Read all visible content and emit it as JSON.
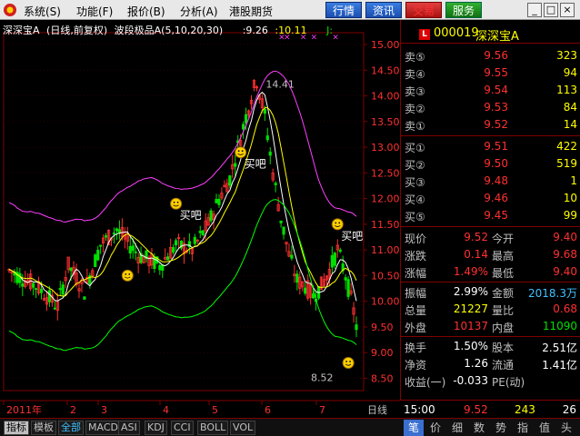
{
  "menu": {
    "items": [
      "系统(S)",
      "功能(F)",
      "报价(B)",
      "分析(A)",
      "港股期货"
    ],
    "buttons": [
      "行情",
      "资讯",
      "交易",
      "服务"
    ],
    "window": [
      "_",
      "□",
      "×"
    ]
  },
  "chart_header": {
    "title": "深深宝A",
    "mode": "(日线,前复权)",
    "indicator": "波段极品A(5,10,20,30)",
    "val1": ":9.26",
    "val2": ":10.11",
    "val3": "J:"
  },
  "annotations": {
    "high": "14.41",
    "low": "8.52",
    "buy": "买吧"
  },
  "xaxis": {
    "labels": [
      "2011年",
      "2",
      "3",
      "4",
      "5",
      "6",
      "7"
    ],
    "period": "日线"
  },
  "chart_data": {
    "type": "candlestick",
    "yaxis_ticks": [
      15.0,
      14.5,
      14.0,
      13.5,
      13.0,
      12.5,
      12.0,
      11.5,
      11.0,
      10.5,
      10.0,
      9.5,
      9.0,
      8.5
    ],
    "ylim": [
      8.26,
      15.23
    ],
    "x_labels": [
      "2011年",
      "2",
      "3",
      "4",
      "5",
      "6",
      "7"
    ],
    "high_label": 14.41,
    "low_label": 8.52
  },
  "quote": {
    "badge": "L",
    "code": "000019",
    "name": "深深宝A",
    "asks": [
      {
        "label": "卖⑤",
        "price": "9.56",
        "vol": "323"
      },
      {
        "label": "卖④",
        "price": "9.55",
        "vol": "94"
      },
      {
        "label": "卖③",
        "price": "9.54",
        "vol": "113"
      },
      {
        "label": "卖②",
        "price": "9.53",
        "vol": "84"
      },
      {
        "label": "卖①",
        "price": "9.52",
        "vol": "14"
      }
    ],
    "bids": [
      {
        "label": "买①",
        "price": "9.51",
        "vol": "422"
      },
      {
        "label": "买②",
        "price": "9.50",
        "vol": "519"
      },
      {
        "label": "买③",
        "price": "9.48",
        "vol": "1"
      },
      {
        "label": "买④",
        "price": "9.46",
        "vol": "10"
      },
      {
        "label": "买⑤",
        "price": "9.45",
        "vol": "99"
      }
    ],
    "stats": [
      {
        "l1": "现价",
        "v1": "9.52",
        "l2": "今开",
        "v2": "9.40"
      },
      {
        "l1": "涨跌",
        "v1": "0.14",
        "l2": "最高",
        "v2": "9.68"
      },
      {
        "l1": "涨幅",
        "v1": "1.49%",
        "l2": "最低",
        "v2": "9.40"
      }
    ],
    "stats2": [
      {
        "l1": "振幅",
        "v1": "2.99%",
        "l2": "金额",
        "v2": "2018.3万"
      },
      {
        "l1": "总量",
        "v1": "21227",
        "l2": "量比",
        "v2": "0.68"
      },
      {
        "l1": "外盘",
        "v1": "10137",
        "l2": "内盘",
        "v2": "11090"
      }
    ],
    "stats3": [
      {
        "l1": "换手",
        "v1": "1.50%",
        "l2": "股本",
        "v2": "2.51亿"
      },
      {
        "l1": "净资",
        "v1": "1.26",
        "l2": "流通",
        "v2": "1.41亿"
      },
      {
        "l1": "收益(一)",
        "v1": "-0.033",
        "l2": "PE(动)",
        "v2": ""
      }
    ],
    "tick": {
      "time": "15:00",
      "price": "9.52",
      "vol": "243",
      "count": "26"
    }
  },
  "bottom_tabs": [
    "指标",
    "模板",
    "全部",
    "MACD",
    "ASI",
    "KDJ",
    "CCI",
    "BOLL",
    "VOL"
  ],
  "right_tabs": [
    "笔",
    "价",
    "细",
    "数",
    "势",
    "指",
    "值",
    "头"
  ],
  "colors": {
    "up": "#ff3030",
    "down": "#00e000",
    "accent": "#ffff00",
    "grid": "#800000"
  }
}
